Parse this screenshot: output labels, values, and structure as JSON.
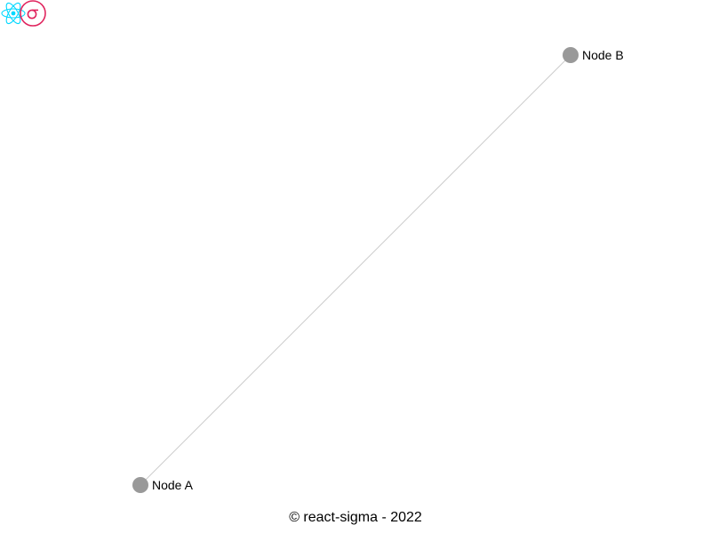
{
  "graph": {
    "nodes": [
      {
        "id": "a",
        "label": "Node A",
        "color": "#999999"
      },
      {
        "id": "b",
        "label": "Node B",
        "color": "#999999"
      }
    ],
    "edges": [
      {
        "source": "a",
        "target": "b",
        "color": "#cccccc"
      }
    ]
  },
  "logo": {
    "react_icon": "react-icon",
    "sigma_icon": "sigma-icon",
    "react_color": "#00d8ff",
    "sigma_color": "#e0245e"
  },
  "footer": {
    "copyright": "© react-sigma - 2022"
  }
}
